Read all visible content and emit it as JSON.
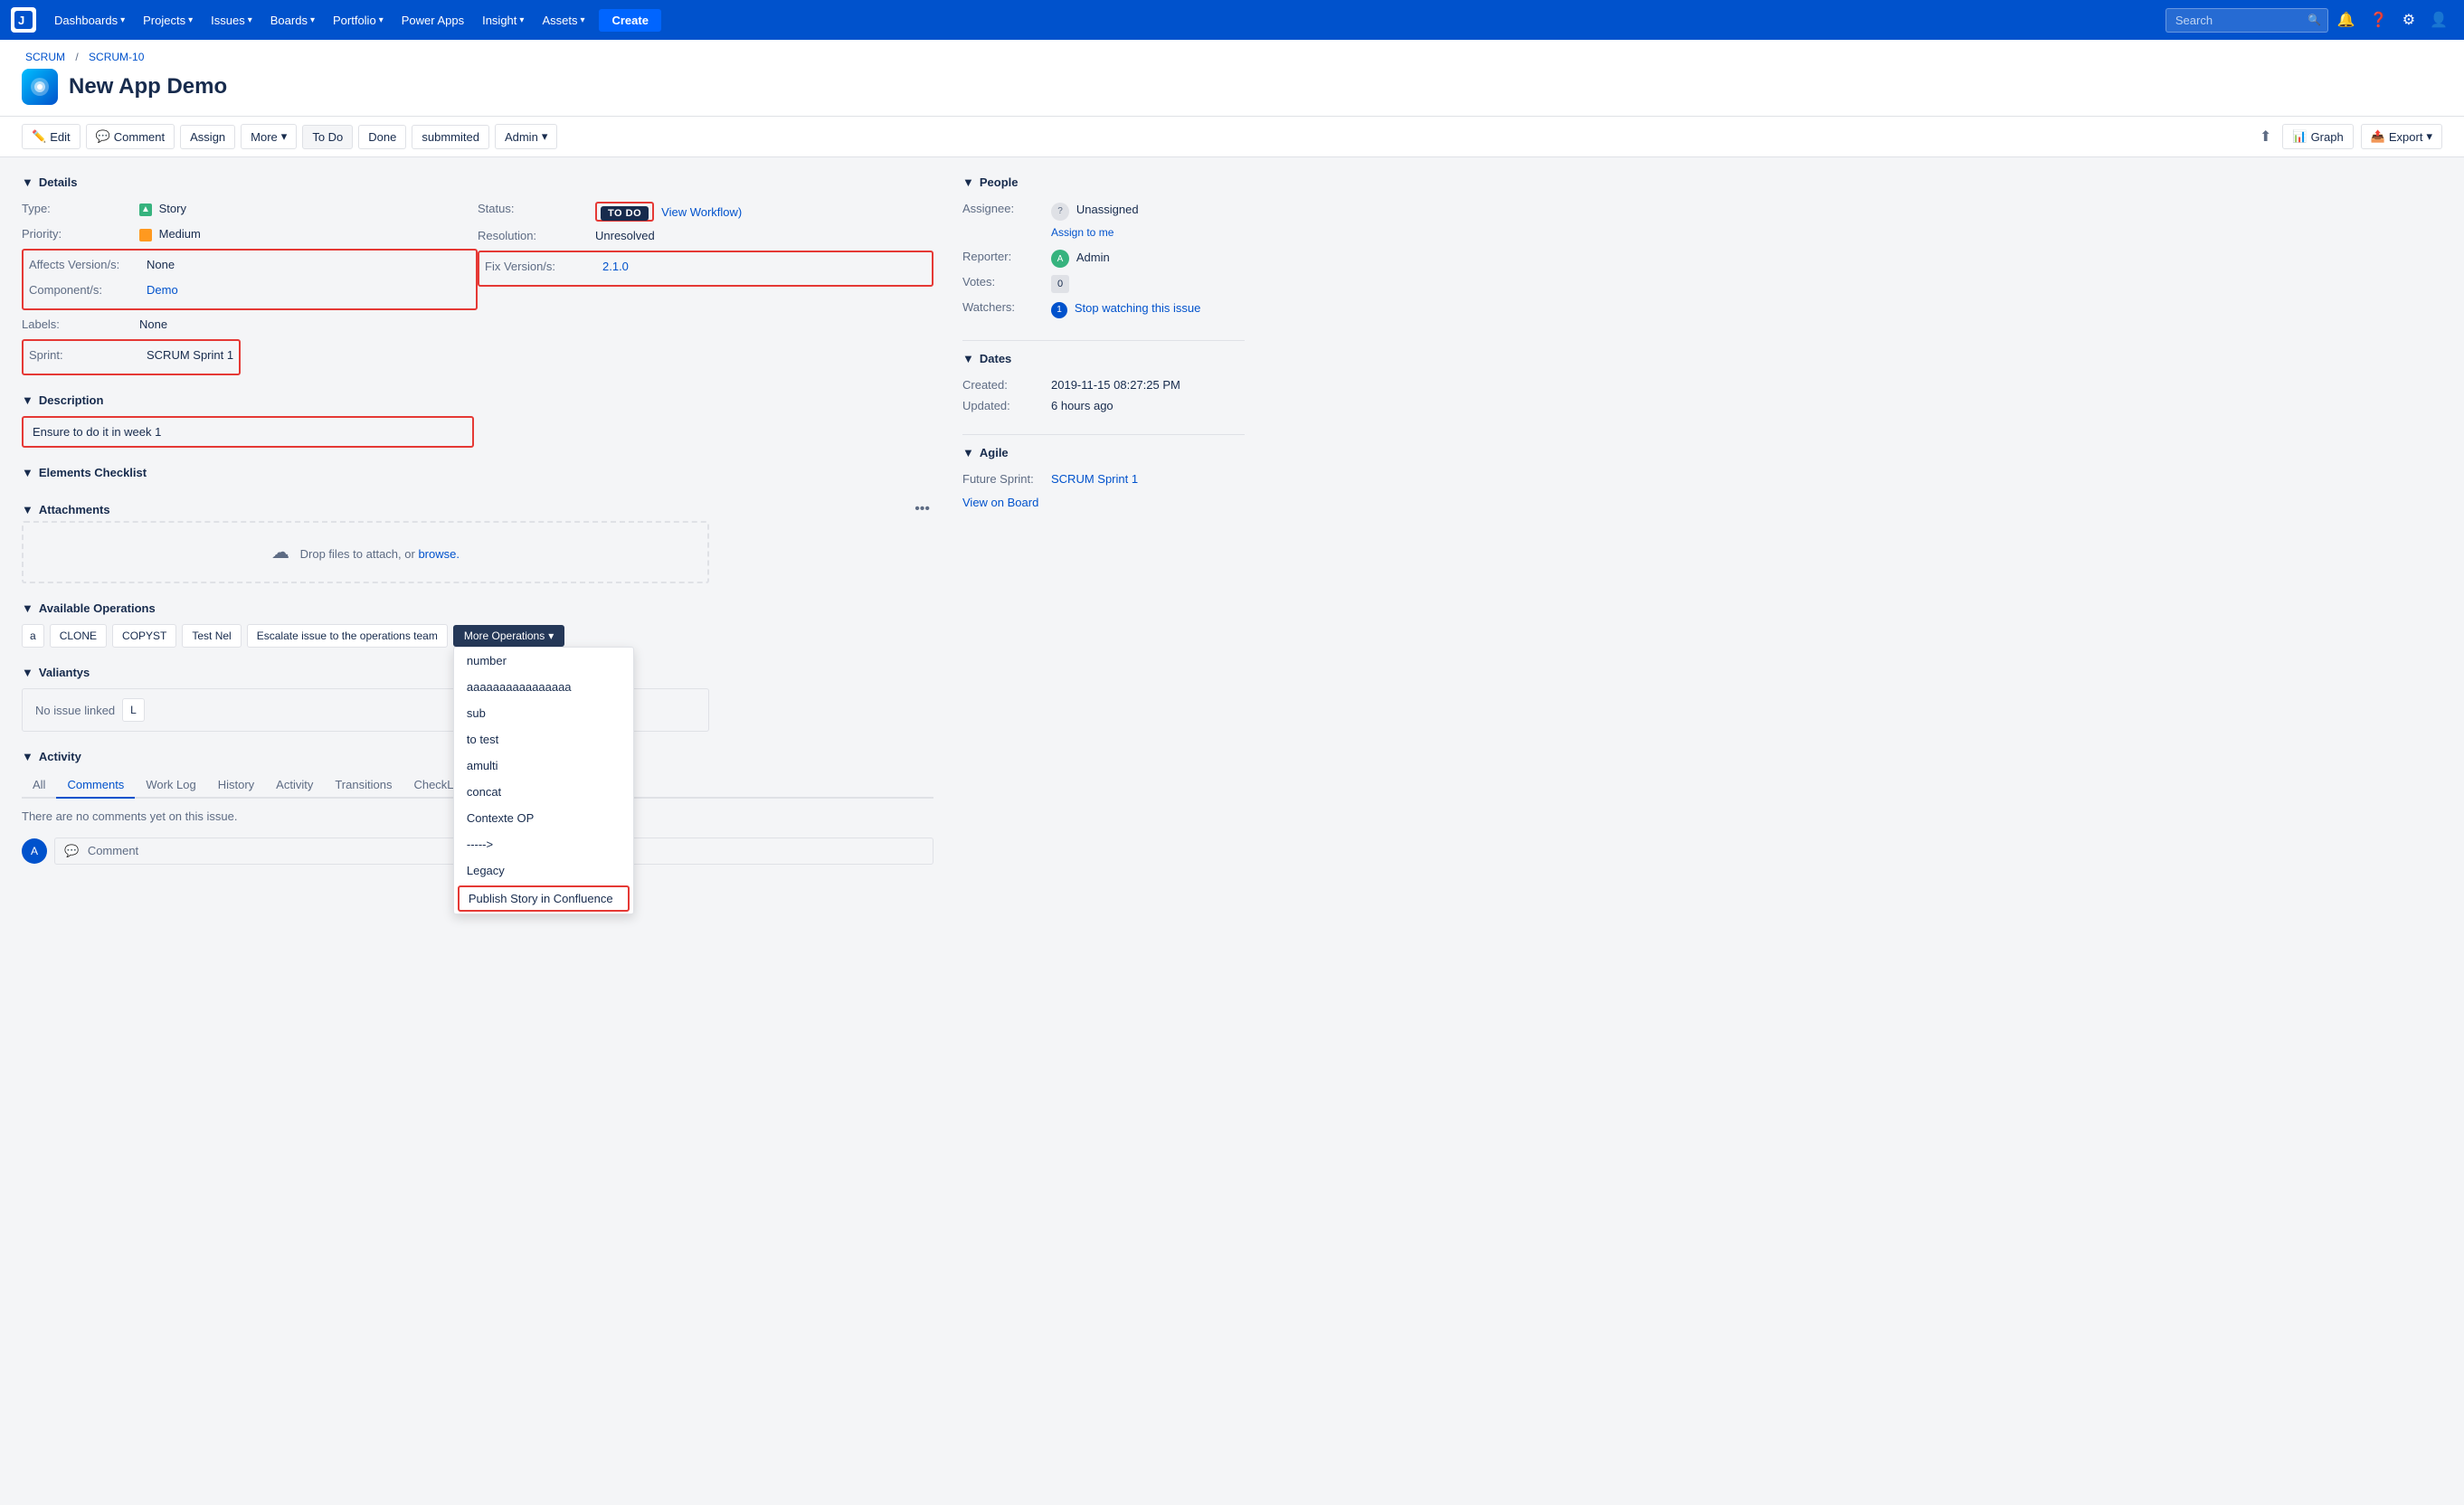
{
  "navbar": {
    "logo": "J",
    "items": [
      {
        "label": "Dashboards",
        "hasDropdown": true
      },
      {
        "label": "Projects",
        "hasDropdown": true
      },
      {
        "label": "Issues",
        "hasDropdown": true
      },
      {
        "label": "Boards",
        "hasDropdown": true
      },
      {
        "label": "Portfolio",
        "hasDropdown": true
      },
      {
        "label": "Power Apps",
        "hasDropdown": false
      },
      {
        "label": "Insight",
        "hasDropdown": true
      },
      {
        "label": "Assets",
        "hasDropdown": true
      }
    ],
    "create_label": "Create",
    "search_placeholder": "Search"
  },
  "breadcrumb": {
    "project": "SCRUM",
    "separator": "/",
    "issue": "SCRUM-10"
  },
  "page": {
    "title": "New App Demo"
  },
  "toolbar": {
    "edit_label": "Edit",
    "comment_label": "Comment",
    "assign_label": "Assign",
    "more_label": "More",
    "more_chevron": "▾",
    "todo_label": "To Do",
    "done_label": "Done",
    "submitted_label": "submmited",
    "admin_label": "Admin",
    "admin_chevron": "▾",
    "share_label": "⬆",
    "graph_label": "Graph",
    "export_label": "Export",
    "export_chevron": "▾"
  },
  "details": {
    "section_label": "Details",
    "type_label": "Type:",
    "type_value": "Story",
    "priority_label": "Priority:",
    "priority_value": "Medium",
    "affects_label": "Affects Version/s:",
    "affects_value": "None",
    "components_label": "Component/s:",
    "components_value": "Demo",
    "labels_label": "Labels:",
    "labels_value": "None",
    "sprint_label": "Sprint:",
    "sprint_value": "SCRUM Sprint 1",
    "status_label": "Status:",
    "status_value": "TO DO",
    "view_workflow_label": "View Workflow)",
    "resolution_label": "Resolution:",
    "resolution_value": "Unresolved",
    "fix_version_label": "Fix Version/s:",
    "fix_version_value": "2.1.0"
  },
  "description": {
    "section_label": "Description",
    "content": "Ensure to do it in week 1"
  },
  "elements_checklist": {
    "section_label": "Elements Checklist"
  },
  "attachments": {
    "section_label": "Attachments",
    "drop_text": "Drop files to attach, or",
    "browse_label": "browse."
  },
  "available_operations": {
    "section_label": "Available Operations",
    "buttons": [
      {
        "label": "a",
        "type": "small"
      },
      {
        "label": "CLONE",
        "type": "normal"
      },
      {
        "label": "COPYST",
        "type": "normal"
      },
      {
        "label": "Test Nel",
        "type": "normal"
      },
      {
        "label": "Escalate issue to the operations team",
        "type": "normal"
      }
    ],
    "more_ops_label": "More Operations",
    "more_ops_chevron": "▾",
    "dropdown_items": [
      {
        "label": "number",
        "highlighted": false
      },
      {
        "label": "aaaaaaaaaaaaaaaa",
        "highlighted": false
      },
      {
        "label": "sub",
        "highlighted": false
      },
      {
        "label": "to test",
        "highlighted": false
      },
      {
        "label": "amulti",
        "highlighted": false
      },
      {
        "label": "concat",
        "highlighted": false
      },
      {
        "label": "Contexte OP",
        "highlighted": false
      },
      {
        "label": "----->",
        "highlighted": false
      },
      {
        "label": "Legacy",
        "highlighted": false
      },
      {
        "label": "Publish Story in Confluence",
        "highlighted": true
      }
    ]
  },
  "valiantys": {
    "section_label": "Valiantys",
    "no_issue_label": "No issue linked",
    "link_btn": "L"
  },
  "activity": {
    "section_label": "Activity",
    "tabs": [
      "All",
      "Comments",
      "Work Log",
      "History",
      "Activity",
      "Transitions",
      "CheckList c"
    ],
    "active_tab": "Comments",
    "no_comments": "There are no comments yet on this issue.",
    "comment_placeholder": "Comment"
  },
  "people": {
    "section_label": "People",
    "assignee_label": "Assignee:",
    "assignee_value": "Unassigned",
    "assign_me_label": "Assign to me",
    "reporter_label": "Reporter:",
    "reporter_value": "Admin",
    "votes_label": "Votes:",
    "votes_value": "0",
    "watchers_label": "Watchers:",
    "watchers_value": "1",
    "stop_watching_label": "Stop watching this issue"
  },
  "dates": {
    "section_label": "Dates",
    "created_label": "Created:",
    "created_value": "2019-11-15 08:27:25 PM",
    "updated_label": "Updated:",
    "updated_value": "6 hours ago"
  },
  "agile": {
    "section_label": "Agile",
    "future_sprint_label": "Future Sprint:",
    "future_sprint_value": "SCRUM Sprint 1",
    "view_board_label": "View on Board"
  }
}
